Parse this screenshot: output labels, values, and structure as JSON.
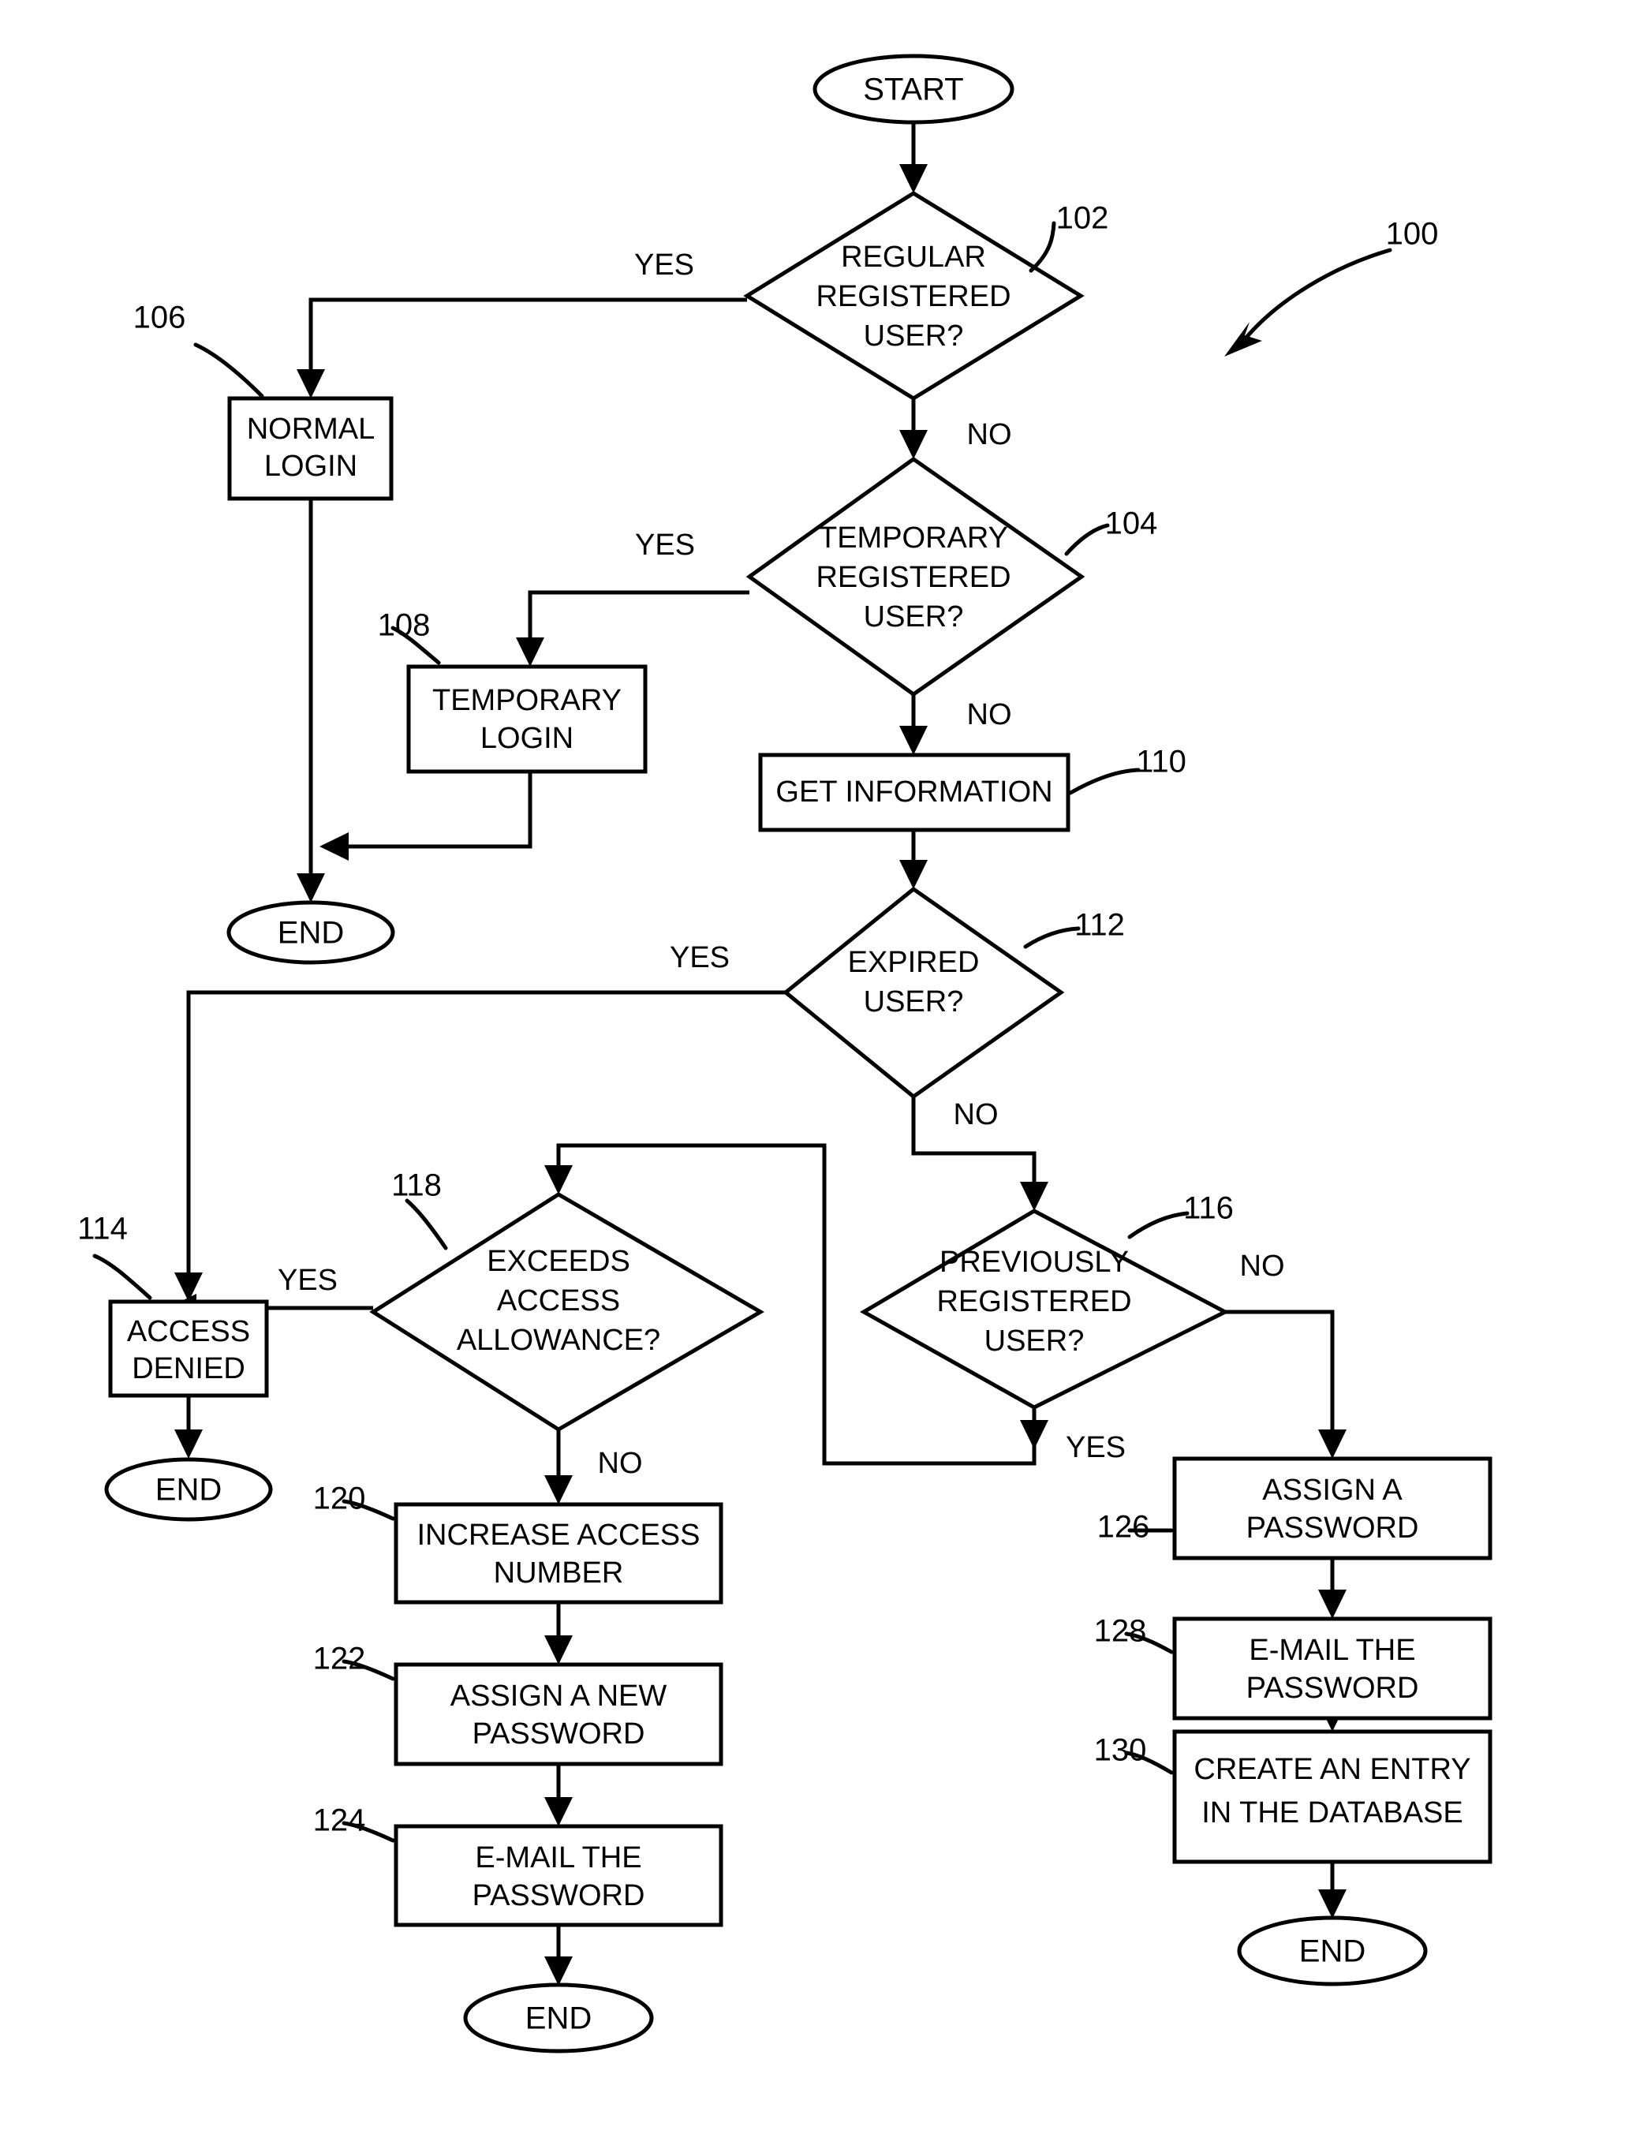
{
  "figure": {
    "reference_numeral": "100",
    "type": "flowchart"
  },
  "nodes": {
    "start": {
      "label": "START",
      "shape": "terminator"
    },
    "n102": {
      "ref": "102",
      "shape": "decision",
      "line1": "REGULAR",
      "line2": "REGISTERED",
      "line3": "USER?"
    },
    "n106": {
      "ref": "106",
      "shape": "process",
      "line1": "NORMAL",
      "line2": "LOGIN"
    },
    "n104": {
      "ref": "104",
      "shape": "decision",
      "line1": "TEMPORARY",
      "line2": "REGISTERED",
      "line3": "USER?"
    },
    "n108": {
      "ref": "108",
      "shape": "process",
      "line1": "TEMPORARY",
      "line2": "LOGIN"
    },
    "n110": {
      "ref": "110",
      "shape": "process",
      "line1": "GET INFORMATION"
    },
    "n112": {
      "ref": "112",
      "shape": "decision",
      "line1": "EXPIRED",
      "line2": "USER?"
    },
    "n118": {
      "ref": "118",
      "shape": "decision",
      "line1": "EXCEEDS",
      "line2": "ACCESS",
      "line3": "ALLOWANCE?"
    },
    "n116": {
      "ref": "116",
      "shape": "decision",
      "line1": "PREVIOUSLY",
      "line2": "REGISTERED",
      "line3": "USER?"
    },
    "n114": {
      "ref": "114",
      "shape": "process",
      "line1": "ACCESS",
      "line2": "DENIED"
    },
    "n120": {
      "ref": "120",
      "shape": "process",
      "line1": "INCREASE ACCESS",
      "line2": "NUMBER"
    },
    "n122": {
      "ref": "122",
      "shape": "process",
      "line1": "ASSIGN A NEW",
      "line2": "PASSWORD"
    },
    "n124": {
      "ref": "124",
      "shape": "process",
      "line1": "E-MAIL THE",
      "line2": "PASSWORD"
    },
    "n126": {
      "ref": "126",
      "shape": "process",
      "line1": "ASSIGN A",
      "line2": "PASSWORD"
    },
    "n128": {
      "ref": "128",
      "shape": "process",
      "line1": "E-MAIL THE",
      "line2": "PASSWORD"
    },
    "n130": {
      "ref": "130",
      "shape": "process",
      "line1": "CREATE AN ENTRY",
      "line2": "IN THE DATABASE"
    },
    "end_login": {
      "label": "END",
      "shape": "terminator"
    },
    "end_denied": {
      "label": "END",
      "shape": "terminator"
    },
    "end_renew": {
      "label": "END",
      "shape": "terminator"
    },
    "end_new": {
      "label": "END",
      "shape": "terminator"
    }
  },
  "edge_labels": {
    "e102_yes": "YES",
    "e102_no": "NO",
    "e104_yes": "YES",
    "e104_no": "NO",
    "e112_yes": "YES",
    "e112_no": "NO",
    "e118_yes": "YES",
    "e118_no": "NO",
    "e116_yes": "YES",
    "e116_no": "NO"
  },
  "colors": {
    "stroke": "#000000",
    "fill": "#ffffff",
    "background": "#ffffff"
  }
}
